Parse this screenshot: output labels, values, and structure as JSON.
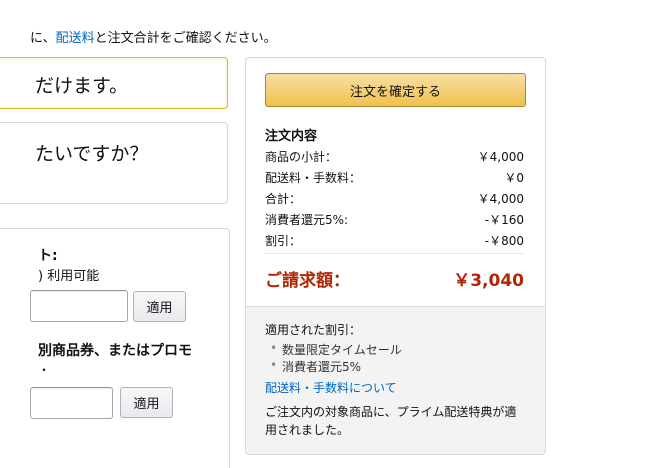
{
  "top_notice": {
    "prefix": "に、",
    "link": "配送料",
    "suffix": "と注文合計をご確認ください。"
  },
  "left": {
    "yellow_box_text": "だけます。",
    "gray_box_text": "たいですか？",
    "gift_title": "ト:",
    "gift_available": ") 利用可能",
    "apply_label": "適用",
    "promo_title": "別商品券、またはプロモ",
    "promo_sub": "・"
  },
  "summary": {
    "place_order_label": "注文を確定する",
    "title": "注文内容",
    "rows": [
      {
        "label": "商品の小計：",
        "value": "￥4,000"
      },
      {
        "label": "配送料・手数料：",
        "value": "￥0"
      },
      {
        "label": "合計：",
        "value": "￥4,000"
      },
      {
        "label": "消費者還元5%:",
        "value": "-￥160"
      },
      {
        "label": "割引：",
        "value": "-￥800"
      }
    ],
    "total_label": "ご請求額：",
    "total_value": "￥3,040",
    "discounts_label": "適用された割引：",
    "discounts": [
      "数量限定タイムセール",
      "消費者還元5%"
    ],
    "shipping_link": "配送料・手数料について",
    "prime_note": "ご注文内の対象商品に、プライム配送特典が適用されました。"
  },
  "colors": {
    "accent_price": "#b12704",
    "link": "#0066c0",
    "button_yellow": "#f0c14b"
  }
}
